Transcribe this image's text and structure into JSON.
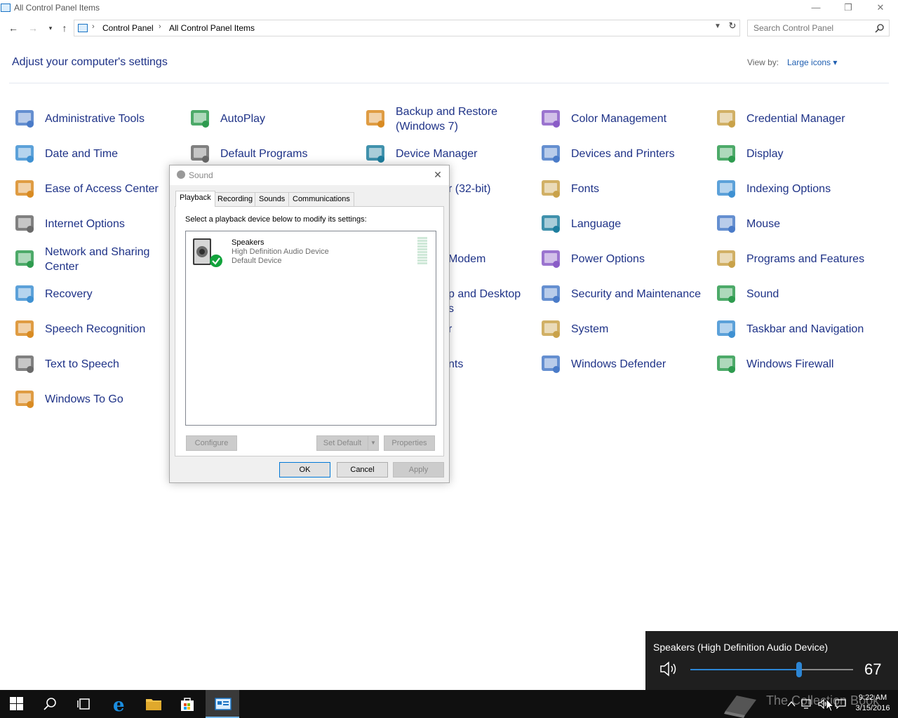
{
  "window": {
    "title": "All Control Panel Items",
    "minimize": "—",
    "restore": "❐",
    "close": "✕"
  },
  "address": {
    "crumbs": [
      "Control Panel",
      "All Control Panel Items"
    ],
    "search_placeholder": "Search Control Panel"
  },
  "heading": "Adjust your computer's settings",
  "view_by": {
    "label": "View by:",
    "value": "Large icons ▾"
  },
  "items": [
    {
      "label": "Administrative Tools",
      "icon": "admin-tools-icon"
    },
    {
      "label": "AutoPlay",
      "icon": "autoplay-icon"
    },
    {
      "label": "Backup and Restore (Windows 7)",
      "icon": "backup-icon"
    },
    {
      "label": "Color Management",
      "icon": "color-management-icon"
    },
    {
      "label": "Credential Manager",
      "icon": "credential-manager-icon"
    },
    {
      "label": "Date and Time",
      "icon": "date-time-icon"
    },
    {
      "label": "Default Programs",
      "icon": "default-programs-icon"
    },
    {
      "label": "Device Manager",
      "icon": "device-manager-icon"
    },
    {
      "label": "Devices and Printers",
      "icon": "devices-printers-icon"
    },
    {
      "label": "Display",
      "icon": "display-icon"
    },
    {
      "label": "Ease of Access Center",
      "icon": "ease-of-access-icon"
    },
    {
      "label": "r (32-bit)",
      "icon": ""
    },
    {
      "label": "Fonts",
      "icon": "fonts-icon"
    },
    {
      "label": "Indexing Options",
      "icon": "indexing-icon"
    },
    {
      "label": "Internet Options",
      "icon": "internet-options-icon"
    },
    {
      "label": "Language",
      "icon": "language-icon"
    },
    {
      "label": "Mouse",
      "icon": "mouse-icon"
    },
    {
      "label": "Network and Sharing Center",
      "icon": "network-icon"
    },
    {
      "label": "Modem",
      "icon": ""
    },
    {
      "label": "Power Options",
      "icon": "power-options-icon"
    },
    {
      "label": "Programs and Features",
      "icon": "programs-features-icon"
    },
    {
      "label": "Recovery",
      "icon": "recovery-icon"
    },
    {
      "label": "p and Desktop",
      "icon": ""
    },
    {
      "label": "s",
      "icon": ""
    },
    {
      "label": "Security and Maintenance",
      "icon": "security-flag-icon"
    },
    {
      "label": "Sound",
      "icon": "sound-icon"
    },
    {
      "label": "Speech Recognition",
      "icon": "microphone-icon"
    },
    {
      "label": "r",
      "icon": ""
    },
    {
      "label": "System",
      "icon": "system-icon"
    },
    {
      "label": "Taskbar and Navigation",
      "icon": "taskbar-icon"
    },
    {
      "label": "Text to Speech",
      "icon": "text-to-speech-icon"
    },
    {
      "label": "nts",
      "icon": ""
    },
    {
      "label": "Windows Defender",
      "icon": "defender-icon"
    },
    {
      "label": "Windows Firewall",
      "icon": "firewall-icon"
    },
    {
      "label": "Windows To Go",
      "icon": "windows-to-go-icon"
    }
  ],
  "sound_dialog": {
    "title": "Sound",
    "close": "✕",
    "tabs": [
      "Playback",
      "Recording",
      "Sounds",
      "Communications"
    ],
    "instruction": "Select a playback device below to modify its settings:",
    "device": {
      "name": "Speakers",
      "description": "High Definition Audio Device",
      "status": "Default Device"
    },
    "buttons": {
      "configure": "Configure",
      "set_default": "Set Default",
      "properties": "Properties",
      "ok": "OK",
      "cancel": "Cancel",
      "apply": "Apply"
    }
  },
  "volume_flyout": {
    "device_label": "Speakers (High Definition Audio Device)",
    "level": 67
  },
  "watermark": "The Collection Book",
  "clock": {
    "time": "9:22 AM",
    "date": "3/15/2016"
  },
  "colors": {
    "link_blue": "#1e3287",
    "accent": "#2c86d5",
    "taskbar": "#101010"
  }
}
